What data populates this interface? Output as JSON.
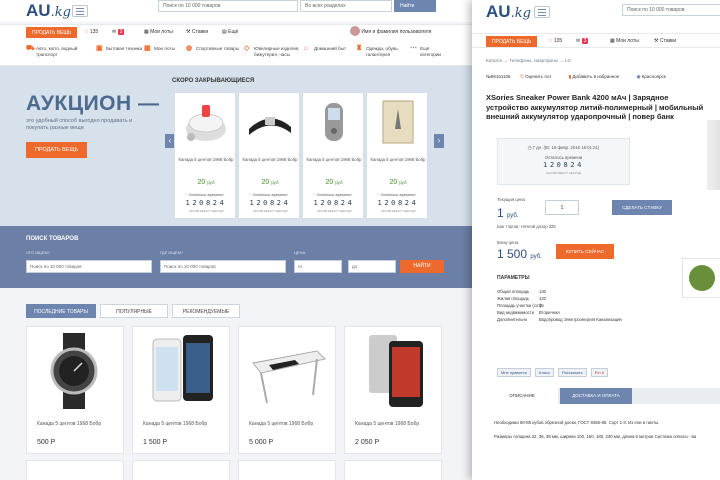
{
  "left_page": {
    "logo": {
      "text": "AU",
      "suffix": ".kg"
    },
    "top_search": {
      "placeholder": "Поиск по 10 000 товаров",
      "category": "Во всех разделах",
      "button": "Найти"
    },
    "sell_button": "ПРОДАТЬ ВЕЩЬ",
    "favorites_count": "135",
    "messages_count": "3",
    "my_lots": "Мои лоты",
    "bets": "Ставки",
    "ads": "Ещё",
    "user_name": "Имя и фамилия пользователя",
    "categories": [
      "Авто, мото, водный транспорт",
      "Бытовая техника",
      "Мои лоты",
      "Спортивные товары",
      "Ювелирные изделия, бижутерия, часы",
      "Домашний быт",
      "Одежда, обувь, галантерея",
      "Ещё категории"
    ],
    "hero": {
      "title": "АУКЦИОН —",
      "text": "это удобный способ выгодно продавать и покупать разные вещи",
      "button": "ПРОДАТЬ ВЕЩЬ",
      "soon_title": "СКОРО ЗАКРЫВАЮЩИЕСЯ"
    },
    "auction_cards": [
      {
        "title": "Канада 5 центов 1968 Бобр",
        "price": "20",
        "currency": "руб",
        "remain_label": "Осталось времени",
        "timer": "120824",
        "timer_units": "ЧАСОВ МИНУТ СЕКУНД",
        "icon": "cotton-candy-machine"
      },
      {
        "title": "Канада 5 центов 1968 Бобр",
        "price": "20",
        "currency": "руб",
        "remain_label": "Осталось времени",
        "timer": "120824",
        "timer_units": "ЧАСОВ МИНУТ СЕКУНД",
        "icon": "belt"
      },
      {
        "title": "Канада 5 центов 1968 Бобр",
        "price": "20",
        "currency": "руб",
        "remain_label": "Осталось времени",
        "timer": "120824",
        "timer_units": "ЧАСОВ МИНУТ СЕКУНД",
        "icon": "phone"
      },
      {
        "title": "Канада 5 центов 1968 Бобр",
        "price": "20",
        "currency": "руб",
        "remain_label": "Осталось времени",
        "timer": "120824",
        "timer_units": "ЧАСОВ МИНУТ СЕКУНД",
        "icon": "book"
      }
    ],
    "search": {
      "heading": "ПОИСК ТОВАРОВ",
      "what_label": "ЧТО ИЩЕМ?",
      "what_placeholder": "Поиск по 10 000 товаров",
      "where_label": "ГДЕ ИЩЕМ?",
      "where_placeholder": "Поиск по 10 000 товаров",
      "price_label": "ЦЕНА",
      "from": "от",
      "to": "до",
      "button": "НАЙТИ"
    },
    "tabs": [
      "ПОСЛЕДНИЕ ТОВАРЫ",
      "ПОПУЛЯРНЫЕ",
      "РЕКОМЕНДУЕМЫЕ"
    ],
    "products": [
      {
        "title": "Канада 5 центов 1968 Бобр",
        "price": "500 Р",
        "icon": "watch"
      },
      {
        "title": "Канада 5 центов 1968 Бобр",
        "price": "1 500 Р",
        "icon": "iphone"
      },
      {
        "title": "Канада 5 центов 1968 Бобр",
        "price": "5 000 Р",
        "icon": "laptop-table"
      },
      {
        "title": "Канада 5 центов 1968 Бобр",
        "price": "2 050 Р",
        "icon": "smartphone-g2"
      }
    ]
  },
  "right_page": {
    "logo": {
      "text": "AU",
      "suffix": ".kg"
    },
    "top_search": {
      "placeholder": "Поиск по 10 000 товаров"
    },
    "sell_button": "ПРОДАТЬ ВЕЩЬ",
    "favorites_count": "135",
    "messages_count": "3",
    "my_lots": "Мои лоты",
    "bets": "Ставки",
    "breadcrumb": "Каталог → Телефоны, смартфоны → LG",
    "lot": {
      "number": "№96161106",
      "rate": "Оценить лот",
      "fav": "Добавить в избранное",
      "city": "Красноярск"
    },
    "title": "XSories Sneaker Power Bank 4200 мАч | Зарядное устройство аккумулятор литий-полимерный | мобильный внешний аккумулятор ударопрочный | повер банк",
    "timer": {
      "date": "7 дн. (Вт. 16 февр. 2016 16:01:21)",
      "remain_label": "Осталось времени",
      "value": "120824",
      "units": "ЧАСОВ МИНУТ СЕКУНД"
    },
    "current_price_label": "Текущая цена",
    "current_price": "1",
    "current_currency": "руб.",
    "qty": "1",
    "bid_button": "СДЕЛАТЬ СТАВКУ",
    "step": "Шаг торгов:  Ночной дозор  325",
    "blitz_label": "Блиц-цена",
    "blitz_price": "1 500",
    "blitz_currency": "руб.",
    "buy_button": "КУПИТЬ СЕЙЧАС",
    "params_title": "ПАРАМЕТРЫ",
    "params": [
      {
        "k": "Общая площадь",
        "v": "130"
      },
      {
        "k": "Жилая площадь",
        "v": "120"
      },
      {
        "k": "Площадь участка (сот)",
        "v": "15"
      },
      {
        "k": "Вид недвижимости",
        "v": "Вторичная"
      },
      {
        "k": "Дополнительно",
        "v": "Водопровод Электроэнергия Канализация"
      }
    ],
    "share": [
      "Мне нравится",
      "Класс",
      "Рассказать",
      "Pin it"
    ],
    "detail_tabs": [
      "ОПИСАНИЕ",
      "ДОСТАВКА И ОПЛАТА"
    ],
    "desc_lines": [
      "Необходимо 80-85 кубов обрезной доски, ГОСТ 8486-86. Сорт 1-3. Из ели и пихты.",
      "Размеры толщина 32, 36, 38 мм, ширина 100, 150, 180, 230 мм, длина 6 метров Система оплаты - ва"
    ]
  }
}
